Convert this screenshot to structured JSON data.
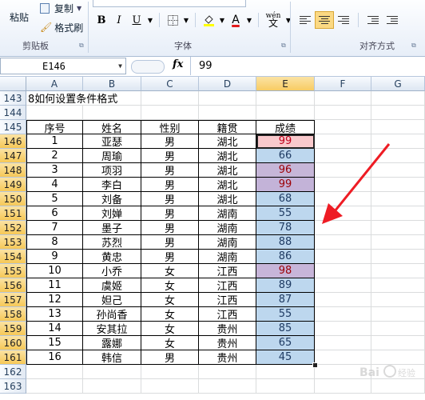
{
  "ribbon": {
    "paste": "粘贴",
    "copy": "复制",
    "format_painter": "格式刷",
    "clipboard_label": "剪贴板",
    "font_label": "字体",
    "align_label": "对齐方式",
    "bold": "B",
    "italic": "I",
    "underline": "U",
    "font_color_glyph": "A",
    "phonetic_glyph": "wén"
  },
  "formula_bar": {
    "name_box": "E146",
    "fx": "fx",
    "value": "99"
  },
  "columns": [
    "A",
    "B",
    "C",
    "D",
    "E",
    "F",
    "G"
  ],
  "row_numbers": [
    "143",
    "144",
    "145",
    "146",
    "147",
    "148",
    "149",
    "150",
    "151",
    "152",
    "153",
    "154",
    "155",
    "156",
    "157",
    "158",
    "159",
    "160",
    "161",
    "162",
    "163"
  ],
  "sheet": {
    "title": "8如何设置条件格式",
    "headers": [
      "序号",
      "姓名",
      "性别",
      "籍贯",
      "成绩"
    ],
    "rows": [
      [
        "1",
        "亚瑟",
        "男",
        "湖北",
        "99"
      ],
      [
        "2",
        "周瑜",
        "男",
        "湖北",
        "66"
      ],
      [
        "3",
        "项羽",
        "男",
        "湖北",
        "96"
      ],
      [
        "4",
        "李白",
        "男",
        "湖北",
        "99"
      ],
      [
        "5",
        "刘备",
        "男",
        "湖北",
        "68"
      ],
      [
        "6",
        "刘婵",
        "男",
        "湖南",
        "55"
      ],
      [
        "7",
        "墨子",
        "男",
        "湖南",
        "78"
      ],
      [
        "8",
        "苏烈",
        "男",
        "湖南",
        "88"
      ],
      [
        "9",
        "黄忠",
        "男",
        "湖南",
        "86"
      ],
      [
        "10",
        "小乔",
        "女",
        "江西",
        "98"
      ],
      [
        "11",
        "虞姬",
        "女",
        "江西",
        "89"
      ],
      [
        "12",
        "妲己",
        "女",
        "江西",
        "87"
      ],
      [
        "13",
        "孙尚香",
        "女",
        "江西",
        "55"
      ],
      [
        "14",
        "安其拉",
        "女",
        "贵州",
        "85"
      ],
      [
        "15",
        "露娜",
        "女",
        "贵州",
        "65"
      ],
      [
        "16",
        "韩信",
        "男",
        "贵州",
        "45"
      ]
    ]
  },
  "highlight_fills": [
    "#f9c9cc",
    "#bdd7ee",
    "#c6b6d8",
    "#c3b3d8",
    "#bdd7ee",
    "#bdd7ee",
    "#bdd7ee",
    "#bdd7ee",
    "#bdd7ee",
    "#c7b5d9",
    "#bdd7ee",
    "#bdd7ee",
    "#bdd7ee",
    "#bdd7ee",
    "#bdd7ee",
    "#bdd7ee"
  ],
  "highlight_text": [
    "#c0001c",
    "#1f3b63",
    "#9c0006",
    "#9c0006",
    "#1f3b63",
    "#1f3b63",
    "#1f3b63",
    "#1f3b63",
    "#1f3b63",
    "#9c0006",
    "#1f3b63",
    "#1f3b63",
    "#1f3b63",
    "#1f3b63",
    "#1f3b63",
    "#1f3b63"
  ],
  "accent_arrow": "#ee1c24",
  "watermark": "Baidu 经验"
}
